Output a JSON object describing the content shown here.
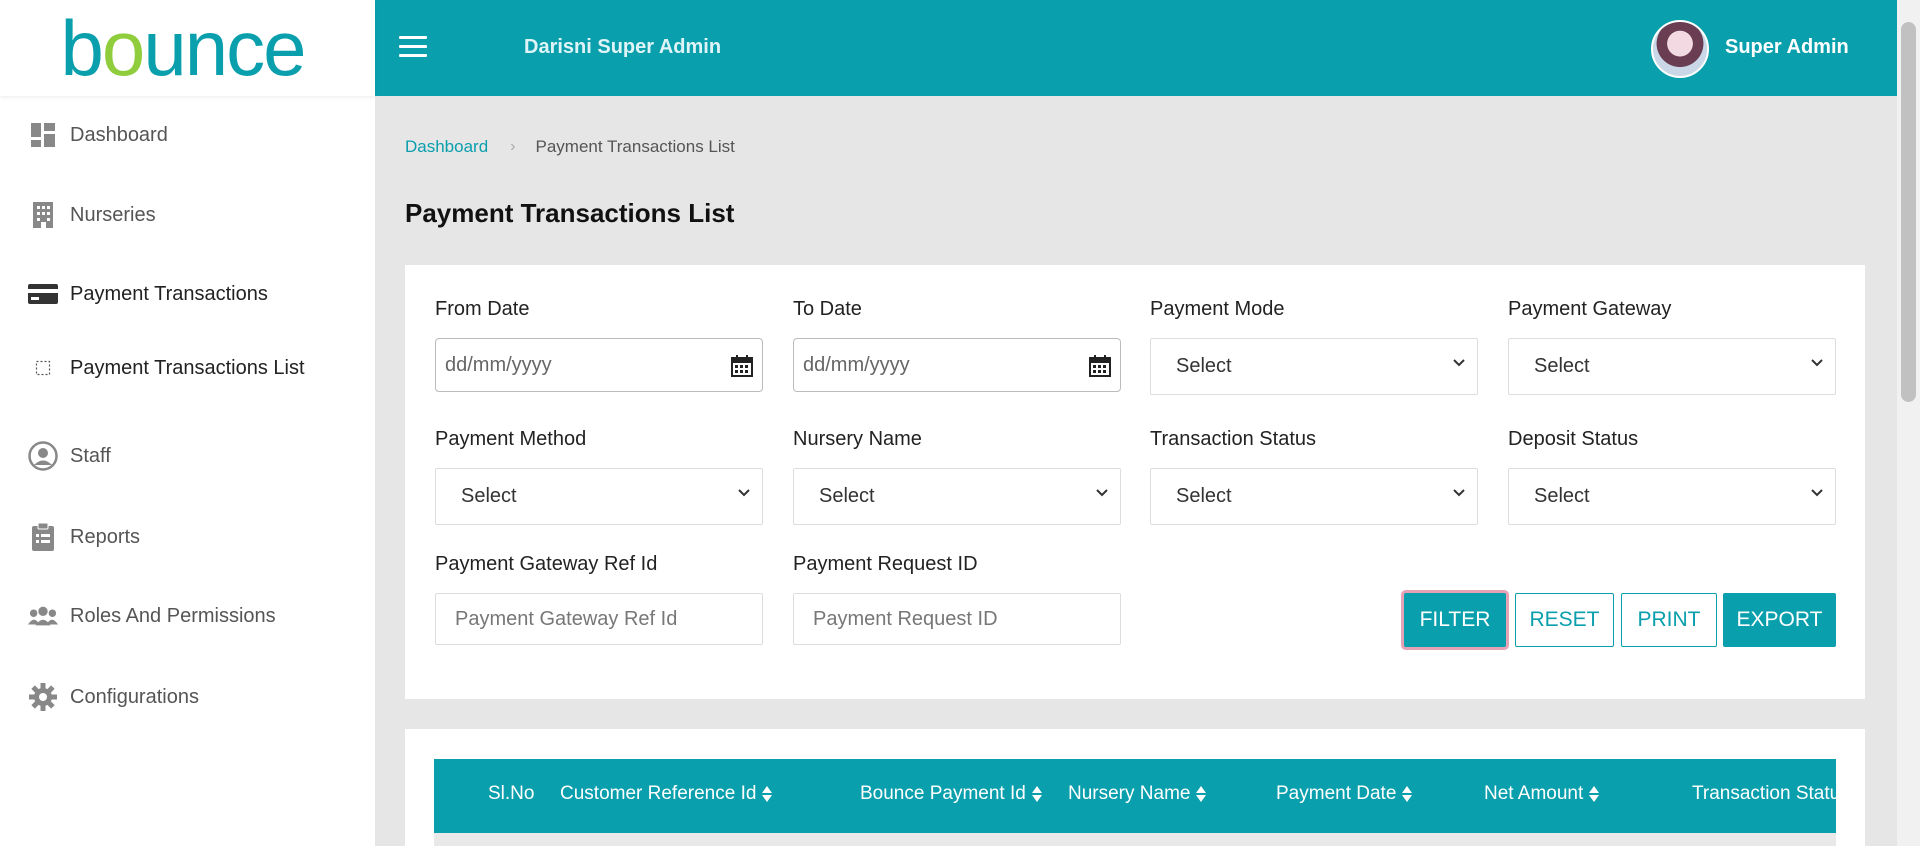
{
  "sidebar": {
    "logo": "bounce",
    "items": [
      {
        "label": "Dashboard",
        "icon": "dashboard-icon"
      },
      {
        "label": "Nurseries",
        "icon": "building-icon"
      },
      {
        "label": "Payment Transactions",
        "icon": "credit-card-icon"
      },
      {
        "label": "Payment Transactions List",
        "icon": "dotted-square-icon"
      },
      {
        "label": "Staff",
        "icon": "user-circle-icon"
      },
      {
        "label": "Reports",
        "icon": "clipboard-icon"
      },
      {
        "label": "Roles And Permissions",
        "icon": "users-group-icon"
      },
      {
        "label": "Configurations",
        "icon": "gear-icon"
      }
    ]
  },
  "header": {
    "app_title": "Darisni Super Admin",
    "user_name": "Super Admin"
  },
  "breadcrumb": {
    "home": "Dashboard",
    "current": "Payment Transactions List"
  },
  "page_title": "Payment Transactions List",
  "filters": {
    "from_date": {
      "label": "From Date",
      "placeholder": "dd/mm/yyyy"
    },
    "to_date": {
      "label": "To Date",
      "placeholder": "dd/mm/yyyy"
    },
    "payment_mode": {
      "label": "Payment Mode",
      "value": "Select"
    },
    "payment_gateway": {
      "label": "Payment Gateway",
      "value": "Select"
    },
    "payment_method": {
      "label": "Payment Method",
      "value": "Select"
    },
    "nursery_name": {
      "label": "Nursery Name",
      "value": "Select"
    },
    "transaction_status": {
      "label": "Transaction Status",
      "value": "Select"
    },
    "deposit_status": {
      "label": "Deposit Status",
      "value": "Select"
    },
    "gateway_ref_id": {
      "label": "Payment Gateway Ref Id",
      "placeholder": "Payment Gateway Ref Id"
    },
    "request_id": {
      "label": "Payment Request ID",
      "placeholder": "Payment Request ID"
    }
  },
  "buttons": {
    "filter": "FILTER",
    "reset": "RESET",
    "print": "PRINT",
    "export": "EXPORT"
  },
  "table": {
    "columns": [
      "Sl.No",
      "Customer Reference Id",
      "Bounce Payment Id",
      "Nursery Name",
      "Payment Date",
      "Net Amount",
      "Transaction Status"
    ]
  },
  "colors": {
    "primary": "#0a9fad",
    "accent_green": "#8fcd3c",
    "background": "#e6e6e6"
  }
}
